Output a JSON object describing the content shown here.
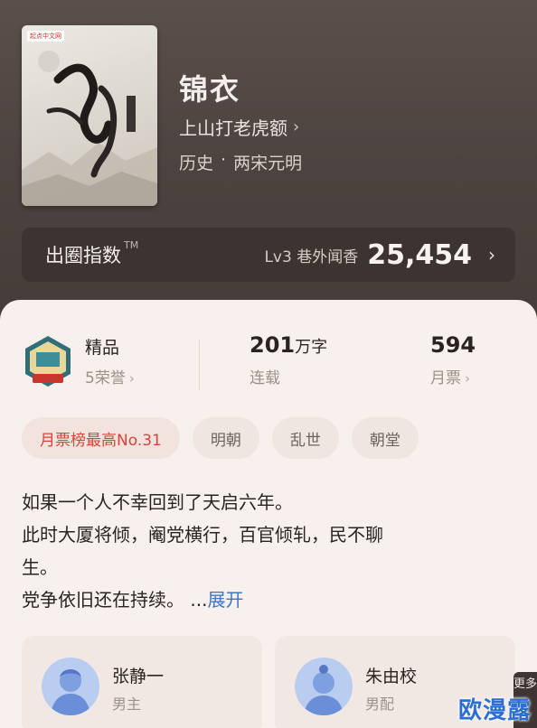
{
  "book": {
    "cover_logo": "起点中文网",
    "title": "锦衣",
    "author": "上山打老虎额",
    "genre_main": "历史",
    "genre_sep": "·",
    "genre_sub": "两宋元明"
  },
  "index": {
    "label": "出圈指数",
    "tm": "TM",
    "level": "Lv3 巷外闻香",
    "value": "25,454"
  },
  "stats": {
    "quality_title": "精品",
    "quality_sub": "5荣誉",
    "words_value": "201",
    "words_unit": "万字",
    "words_status": "连载",
    "tickets_value": "594",
    "tickets_label": "月票"
  },
  "tags": [
    "月票榜最高No.31",
    "明朝",
    "乱世",
    "朝堂"
  ],
  "description": {
    "line1": "如果一个人不幸回到了天启六年。",
    "line2": "此时大厦将倾，阉党横行，百官倾轧，民不聊",
    "line3": "生。",
    "line4": "党争依旧还在持续。",
    "ellipsis": "...",
    "expand": "展开"
  },
  "characters": [
    {
      "name": "张静一",
      "role": "男主"
    },
    {
      "name": "朱由校",
      "role": "男配"
    }
  ],
  "more_tab": "更多",
  "watermark": "欧漫露",
  "colors": {
    "accent_red": "#d6443a",
    "link_blue": "#3a78c9",
    "header_bg": "#4c423f",
    "panel_bg": "#f8f0ec"
  }
}
